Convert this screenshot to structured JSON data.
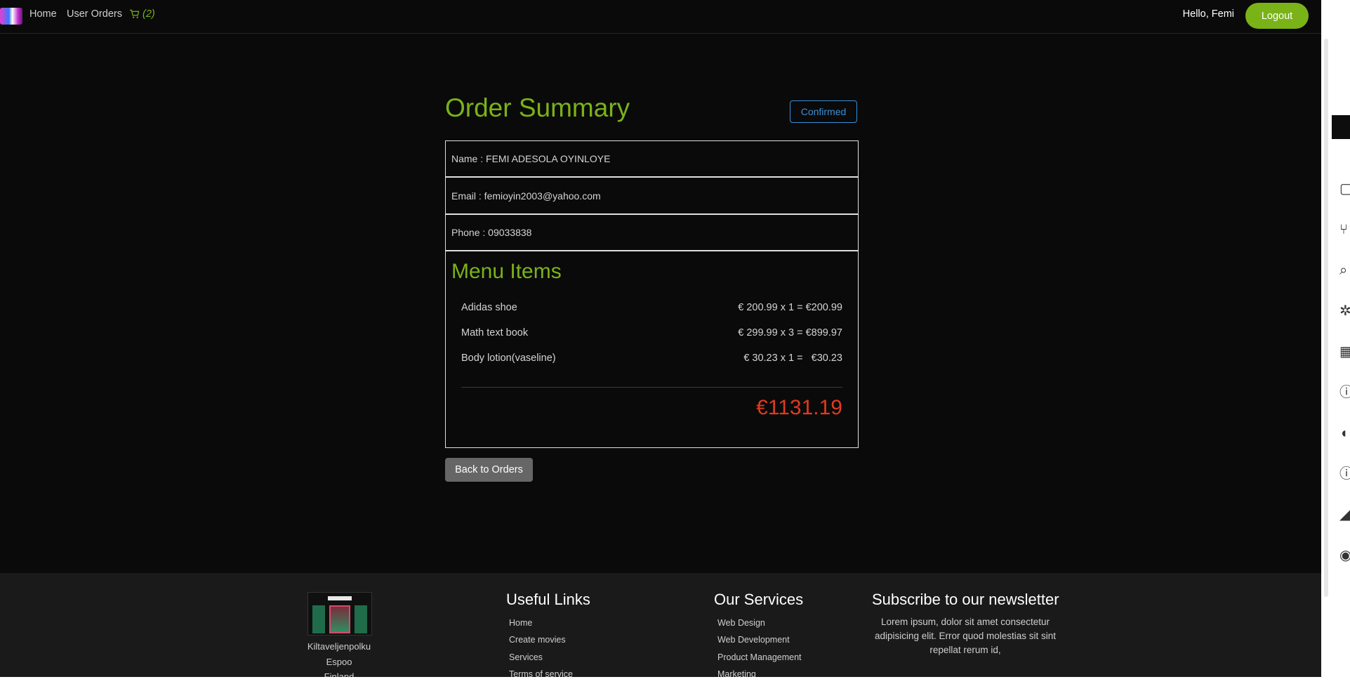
{
  "nav": {
    "home": "Home",
    "user_orders": "User Orders",
    "cart_count": "(2)",
    "greeting": "Hello, Femi",
    "logout": "Logout"
  },
  "order": {
    "title": "Order Summary",
    "status": "Confirmed",
    "name": "Name : FEMI ADESOLA OYINLOYE",
    "email": "Email : femioyin2003@yahoo.com",
    "phone": "Phone : 09033838",
    "menu_title": "Menu Items",
    "items": [
      {
        "name": "Adidas shoe",
        "price": "€ 200.99 x 1 = €200.99"
      },
      {
        "name": "Math text book",
        "price": "€ 299.99 x 3 = €899.97"
      },
      {
        "name": "Body lotion(vaseline)",
        "price": "€ 30.23 x 1 =   €30.23"
      }
    ],
    "total": "€1131.19",
    "back": "Back to Orders"
  },
  "footer": {
    "address": [
      "Kiltaveljenpolku",
      "Espoo",
      "Finland"
    ],
    "useful_links_title": "Useful Links",
    "useful_links": [
      "Home",
      "Create movies",
      "Services",
      "Terms of service"
    ],
    "services_title": "Our Services",
    "services": [
      "Web Design",
      "Web Development",
      "Product Management",
      "Marketing"
    ],
    "newsletter_title": "Subscribe to our newsletter",
    "newsletter_text": "Lorem ipsum, dolor sit amet consectetur adipisicing elit. Error quod molestias sit sint repellat rerum id,"
  },
  "colors": {
    "accent": "#7ab317",
    "status": "#3b8fd6",
    "total": "#e03a1e"
  }
}
